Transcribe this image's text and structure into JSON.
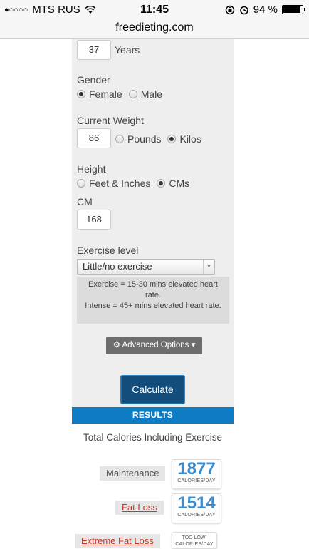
{
  "status": {
    "carrier": "MTS RUS",
    "time": "11:45",
    "battery": "94 %",
    "battery_level": 0.94
  },
  "url": "freedieting.com",
  "form": {
    "age_value": "37",
    "age_unit": "Years",
    "gender_label": "Gender",
    "gender_options": [
      "Female",
      "Male"
    ],
    "gender_selected": "Female",
    "weight_label": "Current Weight",
    "weight_value": "86",
    "weight_units": [
      "Pounds",
      "Kilos"
    ],
    "weight_unit_selected": "Kilos",
    "height_label": "Height",
    "height_units": [
      "Feet & Inches",
      "CMs"
    ],
    "height_unit_selected": "CMs",
    "cm_label": "CM",
    "cm_value": "168",
    "exercise_label": "Exercise level",
    "exercise_selected": "Little/no exercise",
    "exercise_note": "Exercise = 15-30 mins elevated heart rate.\nIntense = 45+ mins elevated heart rate.",
    "advanced_label": "Advanced Options ▾",
    "calculate_label": "Calculate"
  },
  "results": {
    "header": "RESULTS",
    "subtitle": "Total Calories Including Exercise",
    "items": [
      {
        "label": "Maintenance",
        "value": "1877",
        "unit": "CALORIES/DAY"
      },
      {
        "label": "Fat Loss",
        "value": "1514",
        "unit": "CALORIES/DAY"
      },
      {
        "label": "Extreme Fat Loss",
        "value": "TOO LOW!",
        "unit": "CALORIES/DAY"
      }
    ]
  },
  "icons": [
    "signal-dots-icon",
    "wifi-icon",
    "rotation-lock-icon",
    "alarm-icon",
    "battery-icon",
    "gear-icon",
    "chevron-down-icon"
  ]
}
